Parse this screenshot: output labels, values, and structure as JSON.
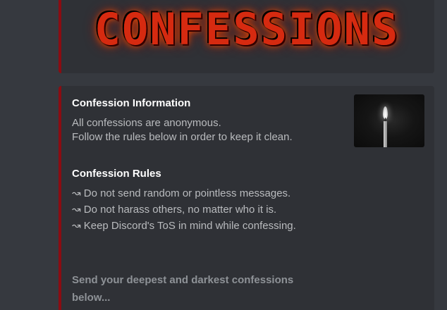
{
  "banner": {
    "text": "Confessions",
    "accent_color": "#8b0c12"
  },
  "info": {
    "title": "Confession Information",
    "lines": [
      "All confessions are anonymous.",
      "Follow the rules below in order to keep it clean."
    ]
  },
  "rules": {
    "title": "Confession Rules",
    "items": [
      "↝ Do not send random or pointless messages.",
      "↝ Do not harass others, no matter who it is.",
      "↝ Keep Discord's ToS in mind while confessing."
    ]
  },
  "closing": {
    "text": "Send your deepest and darkest confessions below..."
  },
  "thumbnail": {
    "icon": "candle-icon"
  }
}
